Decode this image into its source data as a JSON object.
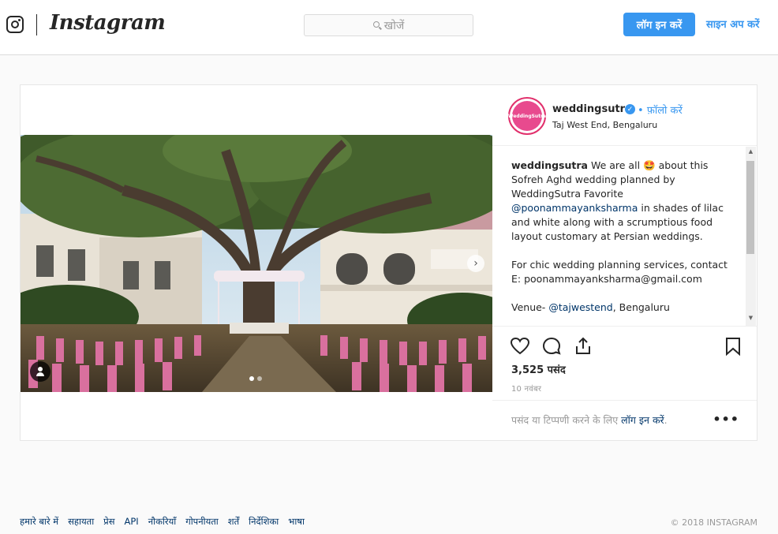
{
  "header": {
    "wordmark": "Instagram",
    "search_placeholder": "खोजें",
    "login_label": "लॉग इन करें",
    "signup_label": "साइन अप करें"
  },
  "post": {
    "username": "weddingsutra",
    "avatar_text": "WeddingSutra",
    "follow_label": "फ़ॉलो करें",
    "location": "Taj West End, Bengaluru",
    "caption": {
      "line1_before": "We are all",
      "emoji": "🤩",
      "line1_after": "about this Sofreh Aghd wedding planned by WeddingSutra Favorite",
      "mention_planner": "@poonammayanksharma",
      "line2": "in shades of lilac and white along with a scrumptious food layout customary at Persian weddings.",
      "line3": "For chic wedding planning services, contact E: poonammayanksharma@gmail.com",
      "venue_prefix": "Venue-",
      "mention_venue": "@tajwestend",
      "venue_suffix": ", Bengaluru"
    },
    "likes": "3,525 पसंद",
    "date": "10 नवंबर",
    "comment_prompt_before": "पसंद या टिप्पणी करने के लिए",
    "comment_prompt_link": "लॉग इन करें",
    "comment_prompt_after": ".",
    "more_label": "•••",
    "carousel": {
      "total": 2,
      "active": 1
    }
  },
  "footer": {
    "links": [
      "हमारे बारे में",
      "सहायता",
      "प्रेस",
      "API",
      "नौकरियाँ",
      "गोपनीयता",
      "शर्तें",
      "निर्देशिका",
      "भाषा"
    ],
    "copyright": "© 2018 INSTAGRAM"
  },
  "colors": {
    "accent": "#3897f0",
    "link": "#003569",
    "border": "#dbdbdb",
    "background": "#fafafa",
    "avatar_pink": "#e84a8e"
  }
}
